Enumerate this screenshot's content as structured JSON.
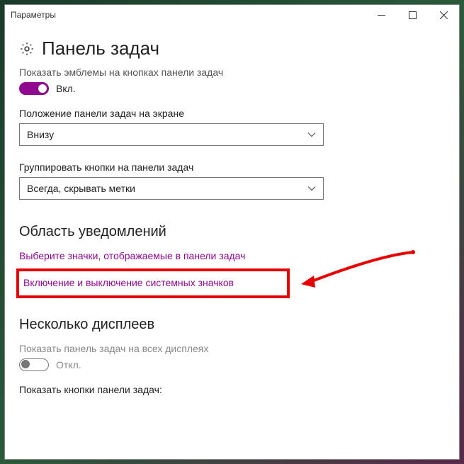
{
  "window": {
    "title": "Параметры"
  },
  "header": {
    "title": "Панель задач"
  },
  "emblem": {
    "label_cut": "Показать эмблемы на кнопках панели задач",
    "state": "Вкл."
  },
  "position": {
    "label": "Положение панели задач на экране",
    "value": "Внизу"
  },
  "group": {
    "label": "Группировать кнопки на панели задач",
    "value": "Всегда, скрывать метки"
  },
  "notif": {
    "heading": "Область уведомлений",
    "link1": "Выберите значки, отображаемые в панели задач",
    "link2": "Включение и выключение системных значков"
  },
  "multi": {
    "heading": "Несколько дисплеев",
    "show_label": "Показать панель задач на всех дисплеях",
    "show_state": "Откл.",
    "buttons_label": "Показать кнопки панели задач:"
  }
}
